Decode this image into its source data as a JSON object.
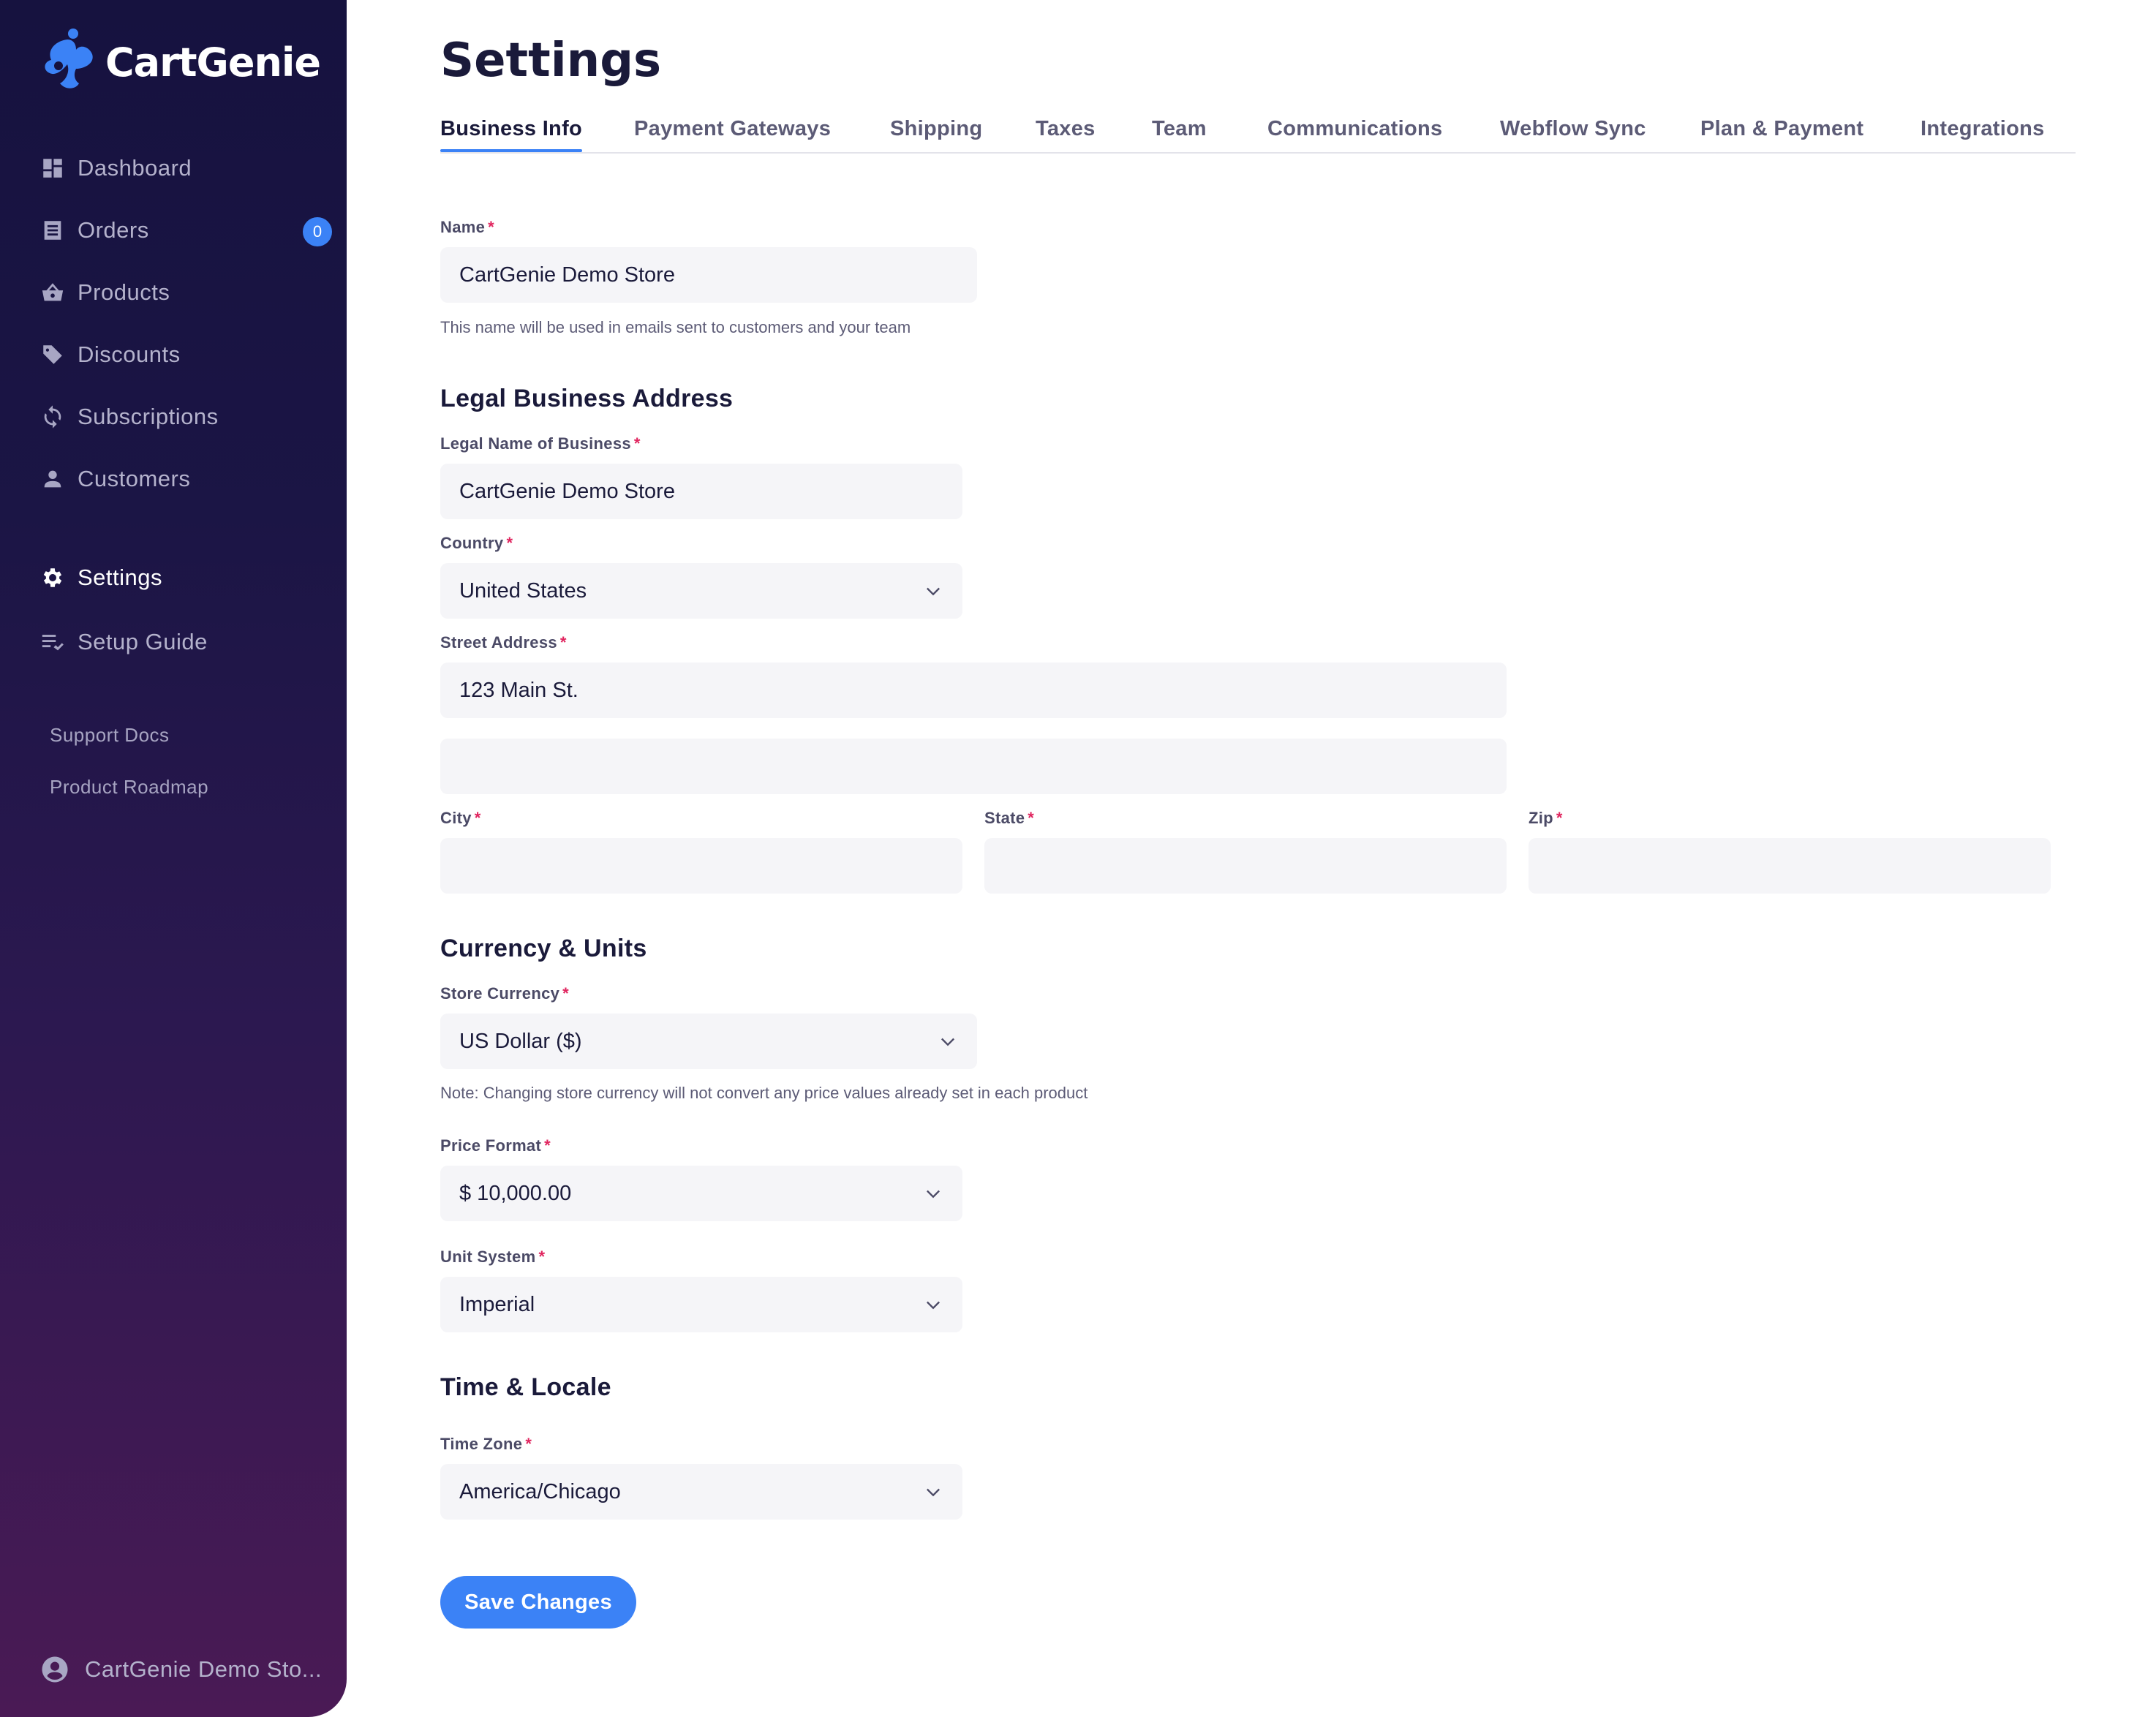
{
  "app": {
    "name": "CartGenie"
  },
  "sidebar": {
    "items": [
      {
        "label": "Dashboard",
        "icon": "dashboard-icon"
      },
      {
        "label": "Orders",
        "icon": "orders-icon",
        "badge": "0"
      },
      {
        "label": "Products",
        "icon": "basket-icon"
      },
      {
        "label": "Discounts",
        "icon": "tag-icon"
      },
      {
        "label": "Subscriptions",
        "icon": "refresh-icon"
      },
      {
        "label": "Customers",
        "icon": "person-icon"
      }
    ],
    "settings": {
      "label": "Settings",
      "icon": "gear-icon",
      "active": true
    },
    "setup_guide": {
      "label": "Setup Guide",
      "icon": "checklist-icon"
    },
    "links": [
      "Support Docs",
      "Product Roadmap"
    ],
    "account": {
      "label": "CartGenie Demo Sto...",
      "icon": "account-circle-icon"
    }
  },
  "page": {
    "title": "Settings",
    "tabs": [
      {
        "label": "Business Info",
        "active": true
      },
      {
        "label": "Payment Gateways"
      },
      {
        "label": "Shipping"
      },
      {
        "label": "Taxes"
      },
      {
        "label": "Team"
      },
      {
        "label": "Communications"
      },
      {
        "label": "Webflow Sync"
      },
      {
        "label": "Plan & Payment"
      },
      {
        "label": "Integrations"
      }
    ]
  },
  "form": {
    "required_mark": "*",
    "name": {
      "label": "Name",
      "value": "CartGenie Demo Store",
      "help": "This name will be used in emails sent to customers and your team"
    },
    "address": {
      "title": "Legal Business Address",
      "legal_name": {
        "label": "Legal Name of Business",
        "value": "CartGenie Demo Store"
      },
      "country": {
        "label": "Country",
        "value": "United States"
      },
      "street": {
        "label": "Street Address",
        "value": "123 Main St.",
        "line2": ""
      },
      "city": {
        "label": "City",
        "value": ""
      },
      "state": {
        "label": "State",
        "value": ""
      },
      "zip": {
        "label": "Zip",
        "value": ""
      }
    },
    "currency": {
      "title": "Currency & Units",
      "store_currency": {
        "label": "Store Currency",
        "value": "US Dollar ($)",
        "note": "Note: Changing store currency will not convert any price values already set in each product"
      },
      "price_format": {
        "label": "Price Format",
        "value": "$ 10,000.00"
      },
      "unit_system": {
        "label": "Unit System",
        "value": "Imperial"
      }
    },
    "locale": {
      "title": "Time & Locale",
      "time_zone": {
        "label": "Time Zone",
        "value": "America/Chicago"
      }
    },
    "save_label": "Save Changes"
  },
  "colors": {
    "accent": "#3b82f6",
    "sidebar_top": "#16123f",
    "sidebar_bottom": "#4a1a55",
    "required": "#e0245e"
  }
}
